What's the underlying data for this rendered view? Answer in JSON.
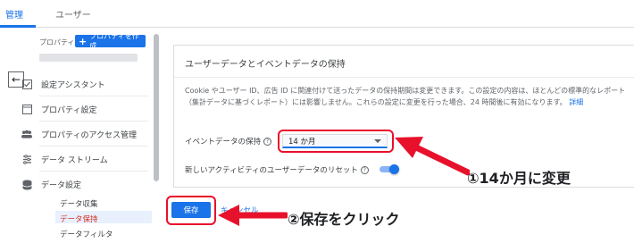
{
  "tabs": [
    {
      "label": "管理",
      "active": true
    },
    {
      "label": "ユーザー",
      "active": false
    }
  ],
  "nav": {
    "property_label": "プロパティ",
    "create_button_label": "プロパティを作成",
    "items": [
      {
        "label": "設定アシスタント",
        "icon": "checkbox-icon"
      },
      {
        "label": "プロパティ設定",
        "icon": "window-icon"
      },
      {
        "label": "プロパティのアクセス管理",
        "icon": "people-icon"
      },
      {
        "label": "データ ストリーム",
        "icon": "stream-icon"
      },
      {
        "label": "データ設定",
        "icon": "database-icon"
      }
    ],
    "sub_items": [
      {
        "label": "データ収集",
        "active": false
      },
      {
        "label": "データ保持",
        "active": true
      },
      {
        "label": "データフィルタ",
        "active": false
      }
    ]
  },
  "card": {
    "title": "ユーザーデータとイベントデータの保持",
    "description": "Cookie やユーザー ID、広告 ID に関連付けて送ったデータの保持期間は変更できます。この設定の内容は、ほとんどの標準的なレポート（集計データに基づくレポート）には影響しません。これらの設定に変更を行った場合、24 時間後に有効になります。",
    "description_link": "詳細",
    "event_retention_label": "イベントデータの保持",
    "event_retention_value": "14 か月",
    "reset_label": "新しいアクティビティのユーザーデータのリセット",
    "reset_enabled": true
  },
  "actions": {
    "save_label": "保存",
    "cancel_label": "キャンセル"
  },
  "annotations": {
    "step1": "①14か月に変更",
    "step2": "②保存をクリック"
  },
  "colors": {
    "accent": "#1a73e8",
    "highlight": "#e8112b"
  }
}
